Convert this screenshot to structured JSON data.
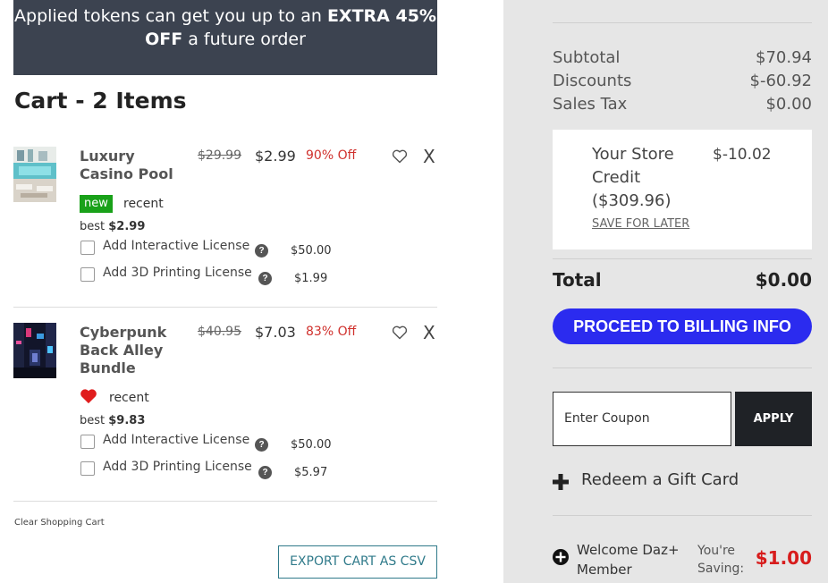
{
  "banner": {
    "part1": "Applied tokens can get you up to an ",
    "bold1": "EXTRA 45%",
    "bold2": "OFF",
    "part2": " a future order"
  },
  "cart": {
    "title": "Cart - 2 Items",
    "items": [
      {
        "name": "Luxury Casino Pool",
        "old_price": "$29.99",
        "price": "$2.99",
        "discount": "90% Off",
        "tag": "new",
        "recent": "recent",
        "best_label": "best ",
        "best_price": "$2.99",
        "licenses": [
          {
            "label": "Add Interactive License",
            "price": "$50.00"
          },
          {
            "label": "Add 3D Printing License",
            "price": "$1.99"
          }
        ],
        "remove": "X"
      },
      {
        "name": "Cyberpunk Back Alley Bundle",
        "old_price": "$40.95",
        "price": "$7.03",
        "discount": "83% Off",
        "recent": "recent",
        "best_label": "best ",
        "best_price": "$9.83",
        "licenses": [
          {
            "label": "Add Interactive License",
            "price": "$50.00"
          },
          {
            "label": "Add 3D Printing License",
            "price": "$5.97"
          }
        ],
        "remove": "X"
      }
    ],
    "help_glyph": "?",
    "clear_label": "Clear Shopping Cart",
    "export_label": "EXPORT CART AS CSV"
  },
  "summary": {
    "subtotal_label": "Subtotal",
    "subtotal": "$70.94",
    "discounts_label": "Discounts",
    "discounts": "$-60.92",
    "tax_label": "Sales Tax",
    "tax": "$0.00",
    "credit_label": "Your Store Credit ($309.96)",
    "credit_value": "$-10.02",
    "save_later": "SAVE FOR LATER",
    "total_label": "Total",
    "total": "$0.00",
    "proceed_label": "PROCEED TO BILLING INFO",
    "coupon_placeholder": "Enter Coupon",
    "apply_label": "APPLY",
    "gift_label": "Redeem a Gift Card",
    "welcome_label": "Welcome Daz+ Member",
    "saving_label": "You're Saving:",
    "saving_value": "$1.00"
  },
  "colors": {
    "banner_bg": "#3c4350",
    "accent": "#2b2bef",
    "discount_red": "#d0312d",
    "new_badge": "#19a119",
    "summary_bg": "#e6e6e6"
  },
  "icons": [
    "heart-outline-icon",
    "heart-filled-icon",
    "help-icon",
    "plus-icon",
    "circle-plus-icon"
  ]
}
